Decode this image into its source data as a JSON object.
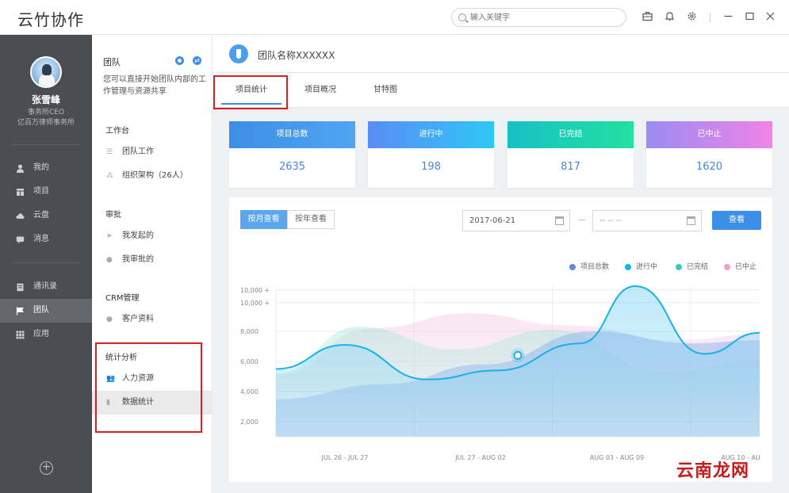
{
  "app": {
    "title": "云竹协作"
  },
  "search": {
    "placeholder": "输入关键字"
  },
  "titlebar": {
    "icons": [
      "briefcase-icon",
      "bell-icon",
      "gear-icon",
      "minimize-icon",
      "maximize-icon",
      "close-icon"
    ]
  },
  "user": {
    "name": "张雪峰",
    "role": "事务所CEO",
    "org": "亿百万律师事务所"
  },
  "sidebar": {
    "items": [
      {
        "label": "我的",
        "icon": "person-icon"
      },
      {
        "label": "项目",
        "icon": "project-icon"
      },
      {
        "label": "云盘",
        "icon": "cloud-icon"
      },
      {
        "label": "消息",
        "icon": "message-icon"
      },
      {
        "label": "通讯录",
        "icon": "contacts-icon"
      },
      {
        "label": "团队",
        "icon": "flag-icon"
      },
      {
        "label": "应用",
        "icon": "apps-icon"
      }
    ],
    "active": "团队"
  },
  "panel2": {
    "title": "团队",
    "description": "您可以直接开始团队内部的工作管理与资源共享",
    "sections": [
      {
        "title": "工作台",
        "items": [
          "团队工作",
          "组织架构（26人）"
        ]
      },
      {
        "title": "审批",
        "items": [
          "我发起的",
          "我审批的"
        ]
      },
      {
        "title": "CRM管理",
        "items": [
          "客户资料"
        ]
      },
      {
        "title": "统计分析",
        "items": [
          "人力资源",
          "数据统计"
        ]
      }
    ],
    "active_item": "数据统计"
  },
  "team": {
    "name": "团队名称XXXXXX"
  },
  "tabs": [
    "项目统计",
    "项目概况",
    "甘特图"
  ],
  "active_tab": "项目统计",
  "stats": [
    {
      "label": "项目总数",
      "value": "2635",
      "colors": [
        "#3d8ee6",
        "#50a5f0"
      ]
    },
    {
      "label": "进行中",
      "value": "198",
      "colors": [
        "#5a8cf5",
        "#2ec8f5"
      ]
    },
    {
      "label": "已完结",
      "value": "817",
      "colors": [
        "#16c1c4",
        "#23e0a0"
      ]
    },
    {
      "label": "已中止",
      "value": "1620",
      "colors": [
        "#9a8cf0",
        "#f083e6"
      ]
    }
  ],
  "filters": {
    "by_month": "按月查看",
    "by_year": "按年查看",
    "start_date": "2017-06-21",
    "end_date": "-- -- --",
    "query": "查看"
  },
  "chart_data": {
    "type": "area",
    "legend": [
      {
        "name": "项目总数",
        "color": "#5a8cd8"
      },
      {
        "name": "进行中",
        "color": "#1ab0e8"
      },
      {
        "name": "已完结",
        "color": "#3cc8c0"
      },
      {
        "name": "已中止",
        "color": "#f0a0c8"
      }
    ],
    "legend_position": "top-right",
    "y_ticks": [
      "10,000 +",
      "10,000 +",
      "8,000",
      "6,000",
      "4,000",
      "2,000"
    ],
    "x_ticks": [
      "JUL 26 - JUL 27",
      "JUL 27 - AUG 02",
      "AUG 03 - AUG 09",
      "AUG 10 - AU"
    ],
    "ylim": [
      0,
      11000
    ],
    "series": [
      {
        "name": "进行中",
        "x": [
          0,
          0.5,
          1.1,
          1.6,
          2.2,
          2.6,
          3.1,
          3.5
        ],
        "values": [
          5500,
          7100,
          4800,
          5400,
          7200,
          11000,
          6500,
          7900
        ]
      },
      {
        "name": "项目总数",
        "x": [
          0,
          0.8,
          1.5,
          2.3,
          3.0,
          3.5
        ],
        "values": [
          3500,
          4500,
          5800,
          8000,
          7200,
          7400
        ]
      },
      {
        "name": "已完结",
        "x": [
          0,
          0.6,
          1.3,
          2.0,
          2.8,
          3.5
        ],
        "values": [
          5200,
          8300,
          6800,
          8100,
          5300,
          6100
        ]
      },
      {
        "name": "已中止",
        "x": [
          0,
          0.7,
          1.4,
          2.1,
          2.9,
          3.5
        ],
        "values": [
          5100,
          8200,
          9200,
          8400,
          7400,
          7800
        ]
      }
    ],
    "marker": {
      "series": "进行中",
      "x": 1.75,
      "value": 6400
    },
    "grid": true
  },
  "watermark": "云南龙网"
}
